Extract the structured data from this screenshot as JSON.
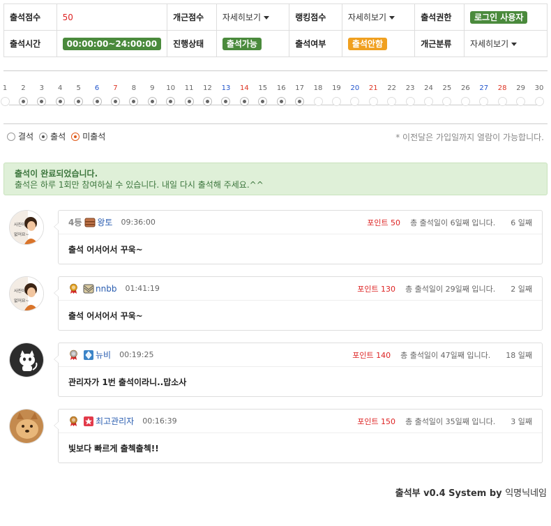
{
  "info": {
    "attendance_score_label": "출석점수",
    "attendance_score_value": "50",
    "perfect_score_label": "개근점수",
    "perfect_score_dropdown": "자세히보기",
    "ranking_score_label": "랭킹점수",
    "ranking_score_dropdown": "자세히보기",
    "permission_label": "출석권한",
    "permission_value": "로그인 사용자",
    "time_label": "출석시간",
    "time_value": "00:00:00~24:00:00",
    "status_label": "진행상태",
    "status_value": "출석가능",
    "attended_label": "출석여부",
    "attended_value": "출석안함",
    "perfect_class_label": "개근분류",
    "perfect_class_dropdown": "자세히보기"
  },
  "calendar": {
    "days": [
      "1",
      "2",
      "3",
      "4",
      "5",
      "6",
      "7",
      "8",
      "9",
      "10",
      "11",
      "12",
      "13",
      "14",
      "15",
      "16",
      "17",
      "18",
      "19",
      "20",
      "21",
      "22",
      "23",
      "24",
      "25",
      "26",
      "27",
      "28",
      "29",
      "30"
    ],
    "blue_days": [
      "6",
      "13",
      "20",
      "27"
    ],
    "red_days": [
      "7",
      "14",
      "21",
      "28"
    ],
    "attended_days": [
      "2",
      "3",
      "4",
      "5",
      "6",
      "7",
      "8",
      "9",
      "10",
      "11",
      "12",
      "13",
      "14",
      "15",
      "16",
      "17"
    ]
  },
  "legend": {
    "absent": "결석",
    "present": "출석",
    "not_attended": "미출석",
    "note": "* 이전달은 가입일까지 열람이 가능합니다."
  },
  "alert": {
    "title": "출석이 완료되었습니다.",
    "message": "출석은 하루 1회만 참여하실 수 있습니다. 내일 다시 출석해 주세요.^^"
  },
  "comments": [
    {
      "rank": "4등",
      "medal": "",
      "level_icon": "level-box-icon",
      "nick": "왕토",
      "time": "09:36:00",
      "points": "포인트 50",
      "total": "총 출석일이 6일째 입니다.",
      "nth": "6 일째",
      "text": "출석 어서어서 꾸욱~"
    },
    {
      "rank": "",
      "medal": "gold-medal-icon",
      "level_icon": "level-envelope-icon",
      "nick": "nnbb",
      "time": "01:41:19",
      "points": "포인트 130",
      "total": "총 출석일이 29일째 입니다.",
      "nth": "2 일째",
      "text": "출석 어서어서 꾸욱~"
    },
    {
      "rank": "",
      "medal": "silver-medal-icon",
      "level_icon": "level-diamond-icon",
      "nick": "뉴비",
      "time": "00:19:25",
      "points": "포인트 140",
      "total": "총 출석일이 47일째 입니다.",
      "nth": "18 일째",
      "text": "관리자가 1번 출석이라니..맙소사"
    },
    {
      "rank": "",
      "medal": "bronze-medal-icon",
      "level_icon": "level-admin-star-icon",
      "nick": "최고관리자",
      "time": "00:16:39",
      "points": "포인트 150",
      "total": "총 출석일이 35일째 입니다.",
      "nth": "3 일째",
      "text": "빛보다 빠르게 출첵출첵!!"
    }
  ],
  "footer": {
    "system": "출석부 v0.4 System by",
    "author": "익명닉네임"
  },
  "avatar_texts": [
    "사진이 없어요~",
    "사진이 없어요~"
  ]
}
